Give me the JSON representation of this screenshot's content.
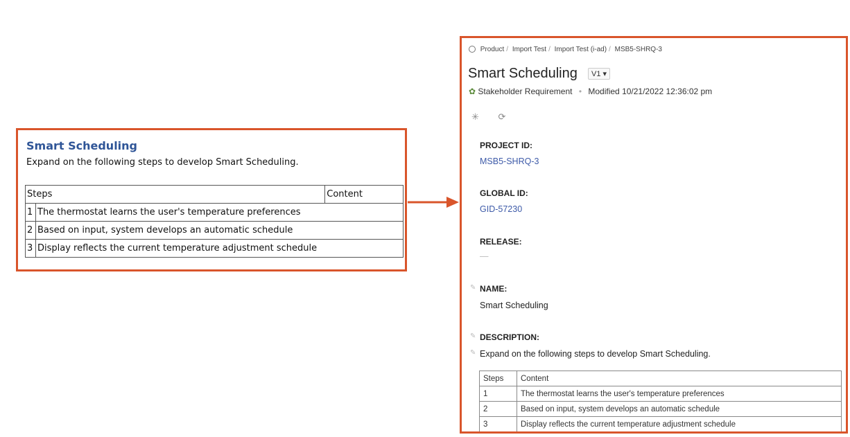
{
  "doc": {
    "title": "Smart Scheduling",
    "intro": "Expand on the following steps to develop Smart Scheduling.",
    "table": {
      "headers": [
        "Steps",
        "Content"
      ],
      "rows": [
        {
          "num": "1",
          "content": "The thermostat learns the user's temperature preferences"
        },
        {
          "num": "2",
          "content": "Based on input, system develops an automatic schedule"
        },
        {
          "num": "3",
          "content": "Display reflects the current temperature adjustment schedule"
        }
      ]
    }
  },
  "colors": {
    "frame": "#d9552b",
    "doc_title": "#2f5597",
    "link": "#3d5aa8"
  },
  "requirement": {
    "breadcrumb": [
      "Product",
      "Import Test",
      "Import Test (i-ad)",
      "MSB5-SHRQ-3"
    ],
    "title": "Smart Scheduling",
    "version": "V1 ▾",
    "type": "Stakeholder Requirement",
    "modified": "Modified 10/21/2022 12:36:02 pm",
    "fields": {
      "project_id_label": "PROJECT ID:",
      "project_id": "MSB5-SHRQ-3",
      "global_id_label": "GLOBAL ID:",
      "global_id": "GID-57230",
      "release_label": "RELEASE:",
      "release": "—",
      "name_label": "NAME:",
      "name": "Smart Scheduling",
      "description_label": "DESCRIPTION:",
      "description": "Expand on the following steps to develop Smart Scheduling."
    },
    "table": {
      "headers": [
        "Steps",
        "Content"
      ],
      "rows": [
        {
          "num": "1",
          "content": "The thermostat learns the user's temperature preferences"
        },
        {
          "num": "2",
          "content": "Based on input, system develops an automatic schedule"
        },
        {
          "num": "3",
          "content": "Display reflects the current temperature adjustment schedule"
        }
      ]
    }
  },
  "icons": [
    "home-icon",
    "requirement-type-icon",
    "settings-icon",
    "refresh-icon",
    "edit-icon",
    "arrow-right-icon"
  ]
}
